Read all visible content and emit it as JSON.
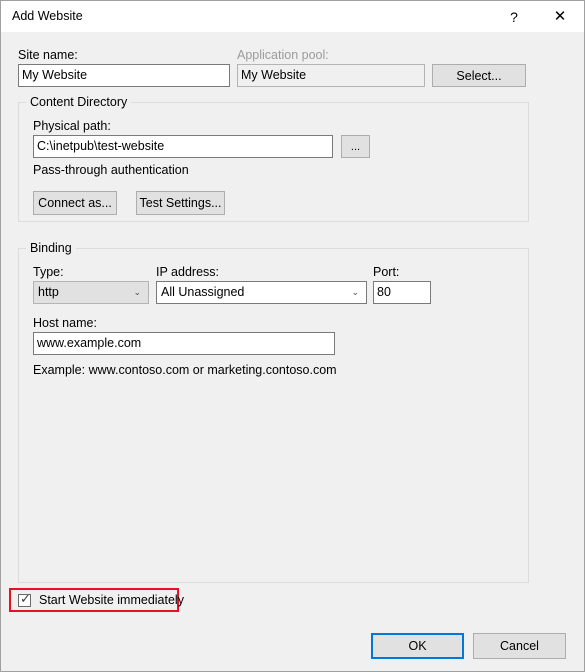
{
  "window": {
    "title": "Add Website",
    "help_glyph": "?",
    "close_glyph": "✕"
  },
  "site_name": {
    "label": "Site name:",
    "value": "My Website"
  },
  "application_pool": {
    "label": "Application pool:",
    "value": "My Website",
    "select_button": "Select..."
  },
  "content_directory": {
    "caption": "Content Directory",
    "physical_path": {
      "label": "Physical path:",
      "value": "C:\\inetpub\\test-website",
      "browse_button": "..."
    },
    "auth_note": "Pass-through authentication",
    "connect_as_button": "Connect as...",
    "test_settings_button": "Test Settings..."
  },
  "binding": {
    "caption": "Binding",
    "type": {
      "label": "Type:",
      "value": "http",
      "chevron": "⌄"
    },
    "ip_address": {
      "label": "IP address:",
      "value": "All Unassigned",
      "chevron": "⌄"
    },
    "port": {
      "label": "Port:",
      "value": "80"
    },
    "host_name": {
      "label": "Host name:",
      "value": "www.example.com"
    },
    "example_hint": "Example: www.contoso.com or marketing.contoso.com"
  },
  "start_website": {
    "label": "Start Website immediately",
    "checked_glyph": "✓",
    "highlight_color": "#e81123"
  },
  "footer": {
    "ok_button": "OK",
    "cancel_button": "Cancel"
  }
}
